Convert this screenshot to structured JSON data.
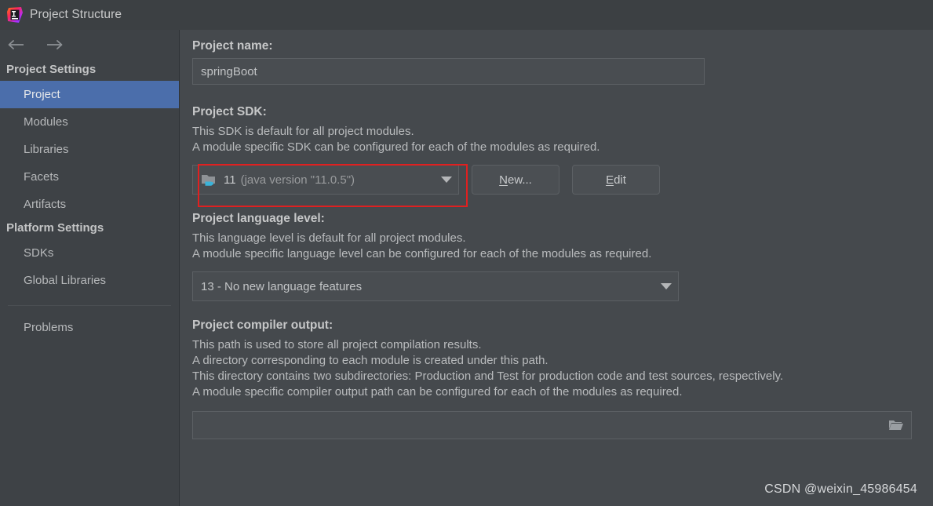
{
  "window": {
    "title": "Project Structure",
    "app_icon": "intellij-idea-logo"
  },
  "sidebar": {
    "back_icon": "arrow-left-icon",
    "forward_icon": "arrow-right-icon",
    "groups": [
      {
        "title": "Project Settings",
        "items": [
          {
            "label": "Project",
            "selected": true
          },
          {
            "label": "Modules",
            "selected": false
          },
          {
            "label": "Libraries",
            "selected": false
          },
          {
            "label": "Facets",
            "selected": false
          },
          {
            "label": "Artifacts",
            "selected": false
          }
        ]
      },
      {
        "title": "Platform Settings",
        "items": [
          {
            "label": "SDKs",
            "selected": false
          },
          {
            "label": "Global Libraries",
            "selected": false
          }
        ]
      }
    ],
    "footer_item": {
      "label": "Problems",
      "selected": false
    }
  },
  "main": {
    "project_name": {
      "label": "Project name:",
      "value": "springBoot",
      "placeholder": ""
    },
    "project_sdk": {
      "label": "Project SDK:",
      "description_line_1": "This SDK is default for all project modules.",
      "description_line_2": "A module specific SDK can be configured for each of the modules as required.",
      "selected_version": "11",
      "selected_detail": "(java version \"11.0.5\")",
      "sdk_icon": "java-sdk-folder-icon",
      "dropdown_icon": "chevron-down-icon",
      "new_button": {
        "prefix": "",
        "mnemonic": "N",
        "suffix": "ew..."
      },
      "edit_button": {
        "prefix": "",
        "mnemonic": "E",
        "suffix": "dit"
      }
    },
    "language_level": {
      "label": "Project language level:",
      "description_line_1": "This language level is default for all project modules.",
      "description_line_2": "A module specific language level can be configured for each of the modules as required.",
      "selected": "13 - No new language features",
      "dropdown_icon": "chevron-down-icon"
    },
    "compiler_output": {
      "label": "Project compiler output:",
      "description_line_1": "This path is used to store all project compilation results.",
      "description_line_2": "A directory corresponding to each module is created under this path.",
      "description_line_3": "This directory contains two subdirectories: Production and Test for production code and test sources, respectively.",
      "description_line_4": "A module specific compiler output path can be configured for each of the modules as required.",
      "value": "",
      "browse_icon": "folder-open-icon"
    }
  },
  "watermark": "CSDN @weixin_45986454",
  "colors": {
    "selection_blue": "#4b6eab",
    "sidebar_bg": "#3e4246",
    "main_bg": "#45494d",
    "titlebar_bg": "#3c4043",
    "annotation_red": "#e02020",
    "java_cup_cyan": "#3ab3d9"
  }
}
